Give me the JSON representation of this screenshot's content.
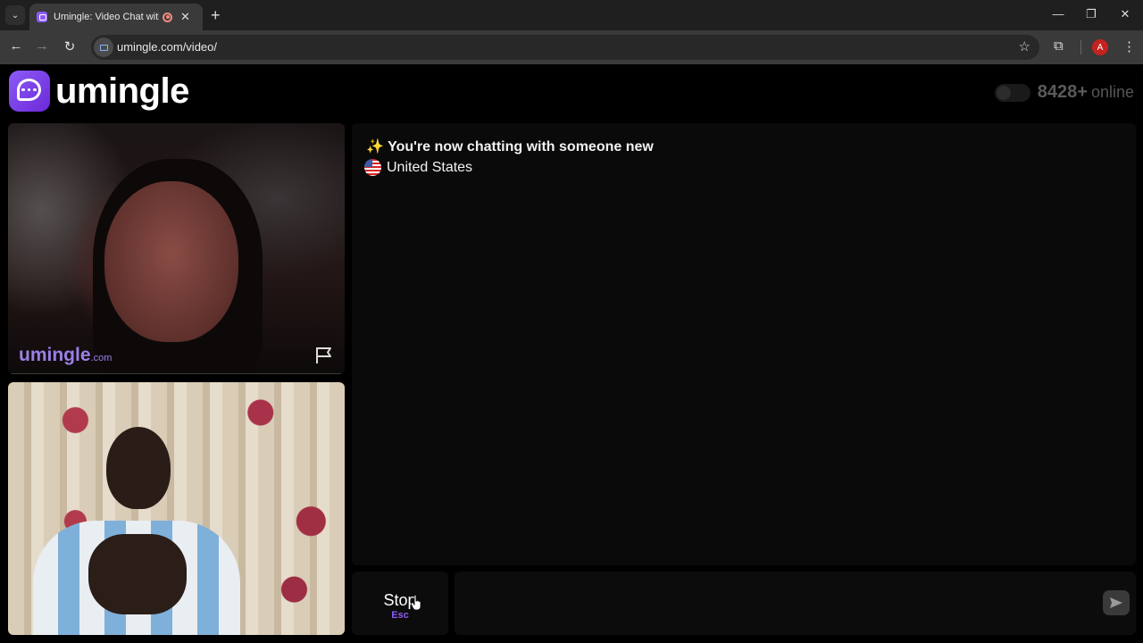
{
  "browser": {
    "tab_title": "Umingle: Video Chat with St",
    "url": "umingle.com/video/",
    "profile_initial": "A",
    "icons": {
      "tab_menu": "chevron-down-icon",
      "close_tab": "close-icon",
      "new_tab": "plus-icon",
      "back": "arrow-left-icon",
      "forward": "arrow-right-icon",
      "reload": "reload-icon",
      "bookmark": "star-icon",
      "extensions": "puzzle-icon",
      "menu": "kebab-icon"
    },
    "glyphs": {
      "tab_menu": "⌄",
      "close_tab": "✕",
      "new_tab": "+",
      "back": "←",
      "forward": "→",
      "reload": "↻",
      "bookmark": "☆",
      "extensions": "⧉",
      "menu": "⋮",
      "minimize": "—",
      "restore": "❐",
      "close_window": "✕"
    }
  },
  "app": {
    "logo_text": "umingle",
    "online_count": "8428+",
    "online_label": "online",
    "stranger_watermark": "umingle",
    "stranger_watermark_suffix": ".com",
    "chat": {
      "status_emoji": "✨",
      "status_message": "You're now chatting with someone new",
      "country": "United States"
    },
    "stop_button": {
      "label": "Stop",
      "shortcut": "Esc"
    },
    "accent_color": "#8b5cf6"
  }
}
